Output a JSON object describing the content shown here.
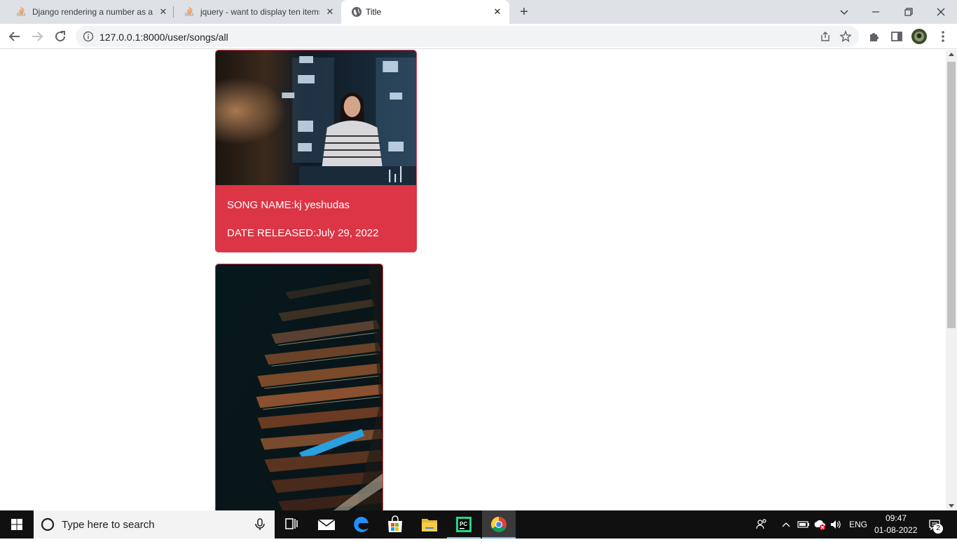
{
  "tabs": [
    {
      "title": "Django rendering a number as a",
      "favicon": "stackoverflow-icon"
    },
    {
      "title": "jquery - want to display ten items",
      "favicon": "stackoverflow-icon"
    },
    {
      "title": "Title",
      "favicon": "globe-icon"
    }
  ],
  "toolbar": {
    "url": "127.0.0.1:8000/user/songs/all"
  },
  "cards": [
    {
      "song_name": "SONG NAME:kj yeshudas",
      "date_released": "DATE RELEASED:July 29, 2022"
    }
  ],
  "taskbar": {
    "search_placeholder": "Type here to search",
    "language": "ENG",
    "time": "09:47",
    "date": "01-08-2022",
    "notification_count": "2"
  },
  "colors": {
    "accent": "#dc3545",
    "tabstrip": "#dee1e6",
    "taskbar": "#101010"
  }
}
